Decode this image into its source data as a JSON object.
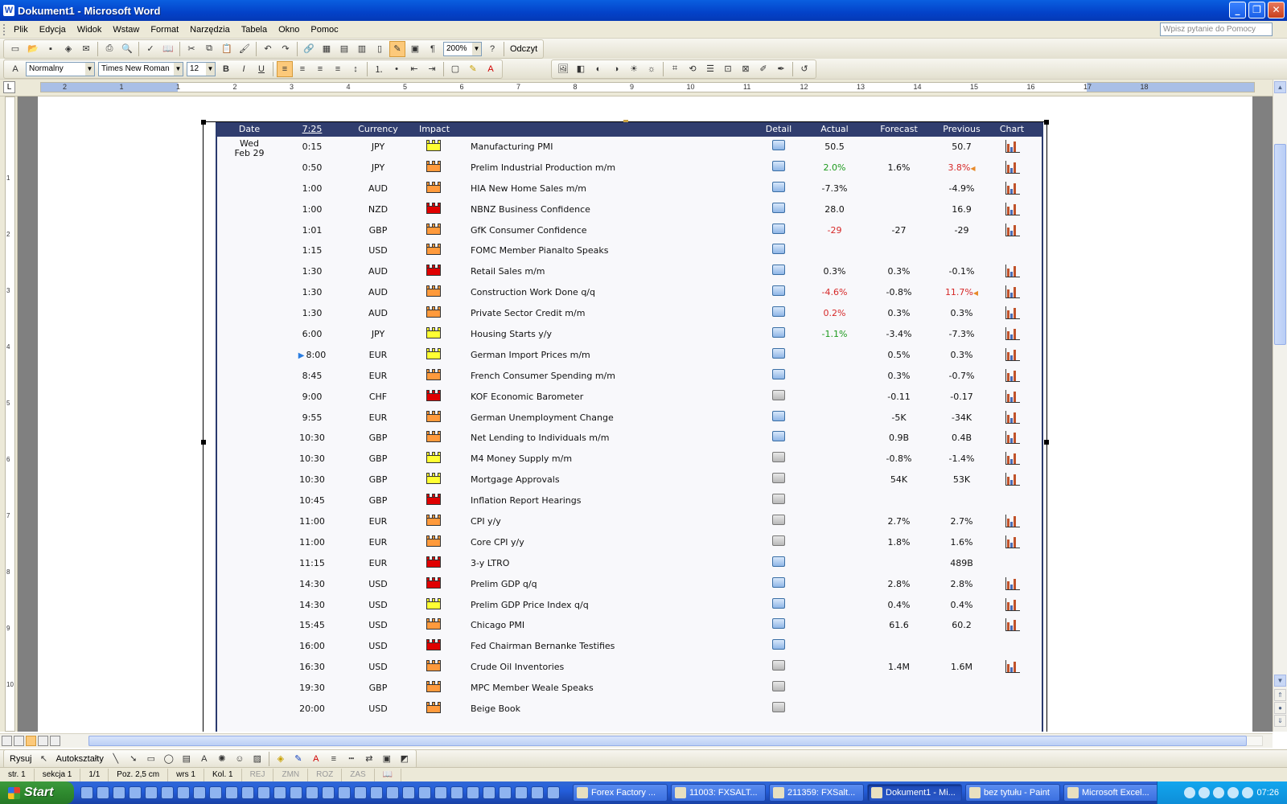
{
  "window": {
    "title": "Dokument1 - Microsoft Word"
  },
  "menu": [
    "Plik",
    "Edycja",
    "Widok",
    "Wstaw",
    "Format",
    "Narzędzia",
    "Tabela",
    "Okno",
    "Pomoc"
  ],
  "help_placeholder": "Wpisz pytanie do Pomocy",
  "toolbar": {
    "zoom": "200%",
    "read_label": "Odczyt",
    "style": "Normalny",
    "font": "Times New Roman",
    "size": "12"
  },
  "ruler": {
    "numbers": [
      "2",
      "1",
      "1",
      "2",
      "3",
      "4",
      "5",
      "6",
      "7",
      "8",
      "9",
      "10",
      "11",
      "12",
      "13",
      "14",
      "15",
      "16",
      "17",
      "18"
    ],
    "vnumbers": [
      "1",
      "2",
      "3",
      "4",
      "5",
      "6",
      "7",
      "8",
      "9",
      "10"
    ]
  },
  "calendar": {
    "headers": {
      "date": "Date",
      "time": "7:25",
      "currency": "Currency",
      "impact": "Impact",
      "detail": "Detail",
      "actual": "Actual",
      "forecast": "Forecast",
      "previous": "Previous",
      "chart": "Chart"
    },
    "date_day": "Wed",
    "date_md": "Feb 29",
    "colors": {
      "high": "#e00000",
      "medium": "#ff9a3c",
      "low": "#ffff33",
      "better": "#1d9a1d",
      "worse": "#d62828"
    },
    "rows": [
      {
        "time": "0:15",
        "cur": "JPY",
        "impact": "low",
        "event": "Manufacturing PMI",
        "actual": "50.5",
        "actual_color": "",
        "forecast": "",
        "previous": "50.7",
        "prev_color": "",
        "prev_rev": false,
        "det": "blue",
        "chart": true
      },
      {
        "time": "0:50",
        "cur": "JPY",
        "impact": "medium",
        "event": "Prelim Industrial Production m/m",
        "actual": "2.0%",
        "actual_color": "better",
        "forecast": "1.6%",
        "previous": "3.8%",
        "prev_color": "worse",
        "prev_rev": true,
        "det": "blue",
        "chart": true
      },
      {
        "time": "1:00",
        "cur": "AUD",
        "impact": "medium",
        "event": "HIA New Home Sales m/m",
        "actual": "-7.3%",
        "actual_color": "",
        "forecast": "",
        "previous": "-4.9%",
        "prev_color": "",
        "prev_rev": false,
        "det": "blue",
        "chart": true
      },
      {
        "time": "1:00",
        "cur": "NZD",
        "impact": "high",
        "event": "NBNZ Business Confidence",
        "actual": "28.0",
        "actual_color": "",
        "forecast": "",
        "previous": "16.9",
        "prev_color": "",
        "prev_rev": false,
        "det": "blue",
        "chart": true
      },
      {
        "time": "1:01",
        "cur": "GBP",
        "impact": "medium",
        "event": "GfK Consumer Confidence",
        "actual": "-29",
        "actual_color": "worse",
        "forecast": "-27",
        "previous": "-29",
        "prev_color": "",
        "prev_rev": false,
        "det": "blue",
        "chart": true
      },
      {
        "time": "1:15",
        "cur": "USD",
        "impact": "medium",
        "event": "FOMC Member Pianalto Speaks",
        "actual": "",
        "actual_color": "",
        "forecast": "",
        "previous": "",
        "prev_color": "",
        "prev_rev": false,
        "det": "blue",
        "chart": false
      },
      {
        "time": "1:30",
        "cur": "AUD",
        "impact": "high",
        "event": "Retail Sales m/m",
        "actual": "0.3%",
        "actual_color": "",
        "forecast": "0.3%",
        "previous": "-0.1%",
        "prev_color": "",
        "prev_rev": false,
        "det": "blue",
        "chart": true
      },
      {
        "time": "1:30",
        "cur": "AUD",
        "impact": "medium",
        "event": "Construction Work Done q/q",
        "actual": "-4.6%",
        "actual_color": "worse",
        "forecast": "-0.8%",
        "previous": "11.7%",
        "prev_color": "worse",
        "prev_rev": true,
        "det": "blue",
        "chart": true
      },
      {
        "time": "1:30",
        "cur": "AUD",
        "impact": "medium",
        "event": "Private Sector Credit m/m",
        "actual": "0.2%",
        "actual_color": "worse",
        "forecast": "0.3%",
        "previous": "0.3%",
        "prev_color": "",
        "prev_rev": false,
        "det": "blue",
        "chart": true
      },
      {
        "time": "6:00",
        "cur": "JPY",
        "impact": "low",
        "event": "Housing Starts y/y",
        "actual": "-1.1%",
        "actual_color": "better",
        "forecast": "-3.4%",
        "previous": "-7.3%",
        "prev_color": "",
        "prev_rev": false,
        "det": "blue",
        "chart": true
      },
      {
        "time": "8:00",
        "cur": "EUR",
        "impact": "low",
        "event": "German Import Prices m/m",
        "actual": "",
        "actual_color": "",
        "forecast": "0.5%",
        "previous": "0.3%",
        "prev_color": "",
        "prev_rev": false,
        "det": "blue",
        "chart": true,
        "next": true
      },
      {
        "time": "8:45",
        "cur": "EUR",
        "impact": "medium",
        "event": "French Consumer Spending m/m",
        "actual": "",
        "actual_color": "",
        "forecast": "0.3%",
        "previous": "-0.7%",
        "prev_color": "",
        "prev_rev": false,
        "det": "blue",
        "chart": true
      },
      {
        "time": "9:00",
        "cur": "CHF",
        "impact": "high",
        "event": "KOF Economic Barometer",
        "actual": "",
        "actual_color": "",
        "forecast": "-0.11",
        "previous": "-0.17",
        "prev_color": "",
        "prev_rev": false,
        "det": "grey",
        "chart": true
      },
      {
        "time": "9:55",
        "cur": "EUR",
        "impact": "medium",
        "event": "German Unemployment Change",
        "actual": "",
        "actual_color": "",
        "forecast": "-5K",
        "previous": "-34K",
        "prev_color": "",
        "prev_rev": false,
        "det": "blue",
        "chart": true
      },
      {
        "time": "10:30",
        "cur": "GBP",
        "impact": "medium",
        "event": "Net Lending to Individuals m/m",
        "actual": "",
        "actual_color": "",
        "forecast": "0.9B",
        "previous": "0.4B",
        "prev_color": "",
        "prev_rev": false,
        "det": "blue",
        "chart": true
      },
      {
        "time": "10:30",
        "cur": "GBP",
        "impact": "low",
        "event": "M4 Money Supply m/m",
        "actual": "",
        "actual_color": "",
        "forecast": "-0.8%",
        "previous": "-1.4%",
        "prev_color": "",
        "prev_rev": false,
        "det": "grey",
        "chart": true
      },
      {
        "time": "10:30",
        "cur": "GBP",
        "impact": "low",
        "event": "Mortgage Approvals",
        "actual": "",
        "actual_color": "",
        "forecast": "54K",
        "previous": "53K",
        "prev_color": "",
        "prev_rev": false,
        "det": "grey",
        "chart": true
      },
      {
        "time": "10:45",
        "cur": "GBP",
        "impact": "high",
        "event": "Inflation Report Hearings",
        "actual": "",
        "actual_color": "",
        "forecast": "",
        "previous": "",
        "prev_color": "",
        "prev_rev": false,
        "det": "grey",
        "chart": false
      },
      {
        "time": "11:00",
        "cur": "EUR",
        "impact": "medium",
        "event": "CPI y/y",
        "actual": "",
        "actual_color": "",
        "forecast": "2.7%",
        "previous": "2.7%",
        "prev_color": "",
        "prev_rev": false,
        "det": "grey",
        "chart": true
      },
      {
        "time": "11:00",
        "cur": "EUR",
        "impact": "medium",
        "event": "Core CPI y/y",
        "actual": "",
        "actual_color": "",
        "forecast": "1.8%",
        "previous": "1.6%",
        "prev_color": "",
        "prev_rev": false,
        "det": "grey",
        "chart": true
      },
      {
        "time": "11:15",
        "cur": "EUR",
        "impact": "high",
        "event": "3-y LTRO",
        "actual": "",
        "actual_color": "",
        "forecast": "",
        "previous": "489B",
        "prev_color": "",
        "prev_rev": false,
        "det": "blue",
        "chart": false
      },
      {
        "time": "14:30",
        "cur": "USD",
        "impact": "high",
        "event": "Prelim GDP q/q",
        "actual": "",
        "actual_color": "",
        "forecast": "2.8%",
        "previous": "2.8%",
        "prev_color": "",
        "prev_rev": false,
        "det": "blue",
        "chart": true
      },
      {
        "time": "14:30",
        "cur": "USD",
        "impact": "low",
        "event": "Prelim GDP Price Index q/q",
        "actual": "",
        "actual_color": "",
        "forecast": "0.4%",
        "previous": "0.4%",
        "prev_color": "",
        "prev_rev": false,
        "det": "blue",
        "chart": true
      },
      {
        "time": "15:45",
        "cur": "USD",
        "impact": "medium",
        "event": "Chicago PMI",
        "actual": "",
        "actual_color": "",
        "forecast": "61.6",
        "previous": "60.2",
        "prev_color": "",
        "prev_rev": false,
        "det": "blue",
        "chart": true
      },
      {
        "time": "16:00",
        "cur": "USD",
        "impact": "high",
        "event": "Fed Chairman Bernanke Testifies",
        "actual": "",
        "actual_color": "",
        "forecast": "",
        "previous": "",
        "prev_color": "",
        "prev_rev": false,
        "det": "blue",
        "chart": false
      },
      {
        "time": "16:30",
        "cur": "USD",
        "impact": "medium",
        "event": "Crude Oil Inventories",
        "actual": "",
        "actual_color": "",
        "forecast": "1.4M",
        "previous": "1.6M",
        "prev_color": "",
        "prev_rev": false,
        "det": "grey",
        "chart": true
      },
      {
        "time": "19:30",
        "cur": "GBP",
        "impact": "medium",
        "event": "MPC Member Weale Speaks",
        "actual": "",
        "actual_color": "",
        "forecast": "",
        "previous": "",
        "prev_color": "",
        "prev_rev": false,
        "det": "grey",
        "chart": false
      },
      {
        "time": "20:00",
        "cur": "USD",
        "impact": "medium",
        "event": "Beige Book",
        "actual": "",
        "actual_color": "",
        "forecast": "",
        "previous": "",
        "prev_color": "",
        "prev_rev": false,
        "det": "grey",
        "chart": false
      }
    ]
  },
  "drawing": {
    "draw_label": "Rysuj",
    "autoshapes_label": "Autokształty"
  },
  "status": {
    "page": "str. 1",
    "section": "sekcja 1",
    "pages": "1/1",
    "pos": "Poz. 2,5 cm",
    "line": "wrs 1",
    "col": "Kol. 1",
    "rec": "REJ",
    "trk": "ZMN",
    "ext": "ROZ",
    "ovr": "ZAS"
  },
  "taskbar": {
    "start": "Start",
    "tasks": [
      "Forex Factory ...",
      "11003: FXSALT...",
      "211359: FXSalt...",
      "Dokument1 - Mi...",
      "bez tytułu - Paint",
      "Microsoft Excel..."
    ],
    "active_index": 3,
    "clock": "07:26"
  }
}
